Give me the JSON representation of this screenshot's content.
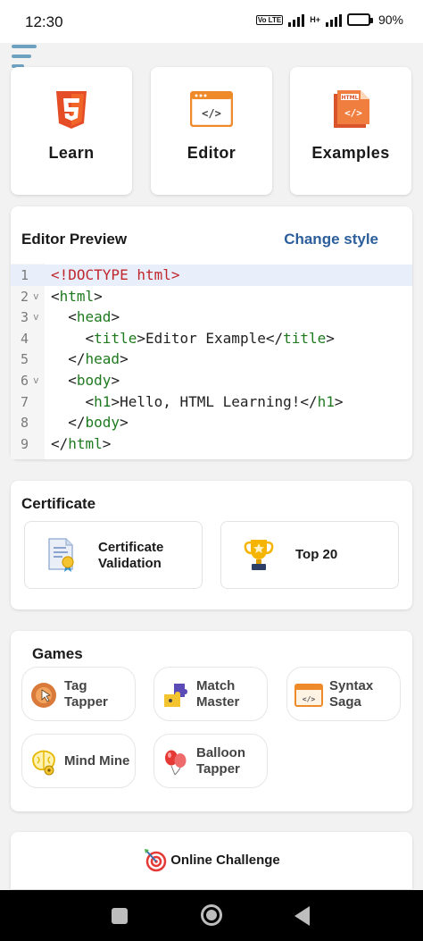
{
  "status_bar": {
    "time": "12:30",
    "battery": "90%",
    "network_tag": "Vo LTE",
    "signal_tag": "H+"
  },
  "tiles": [
    {
      "label": "Learn",
      "icon": "html5-icon"
    },
    {
      "label": "Editor",
      "icon": "code-editor-icon"
    },
    {
      "label": "Examples",
      "icon": "html-document-icon"
    }
  ],
  "editor": {
    "title": "Editor Preview",
    "change_style": "Change style",
    "lines": [
      {
        "num": "1",
        "fold": "",
        "parts": [
          {
            "t": "<!DOCTYPE html>",
            "c": "doc"
          }
        ]
      },
      {
        "num": "2",
        "fold": "v",
        "parts": [
          {
            "t": "<",
            "c": ""
          },
          {
            "t": "html",
            "c": "tag"
          },
          {
            "t": ">",
            "c": ""
          }
        ]
      },
      {
        "num": "3",
        "fold": "v",
        "parts": [
          {
            "t": "  <",
            "c": ""
          },
          {
            "t": "head",
            "c": "tag"
          },
          {
            "t": ">",
            "c": ""
          }
        ]
      },
      {
        "num": "4",
        "fold": "",
        "parts": [
          {
            "t": "    <",
            "c": ""
          },
          {
            "t": "title",
            "c": "tag"
          },
          {
            "t": ">Editor Example</",
            "c": ""
          },
          {
            "t": "title",
            "c": "tag"
          },
          {
            "t": ">",
            "c": ""
          }
        ]
      },
      {
        "num": "5",
        "fold": "",
        "parts": [
          {
            "t": "  </",
            "c": ""
          },
          {
            "t": "head",
            "c": "tag"
          },
          {
            "t": ">",
            "c": ""
          }
        ]
      },
      {
        "num": "6",
        "fold": "v",
        "parts": [
          {
            "t": "  <",
            "c": ""
          },
          {
            "t": "body",
            "c": "tag"
          },
          {
            "t": ">",
            "c": ""
          }
        ]
      },
      {
        "num": "7",
        "fold": "",
        "parts": [
          {
            "t": "    <",
            "c": ""
          },
          {
            "t": "h1",
            "c": "tag"
          },
          {
            "t": ">Hello, HTML Learning!</",
            "c": ""
          },
          {
            "t": "h1",
            "c": "tag"
          },
          {
            "t": ">",
            "c": ""
          }
        ]
      },
      {
        "num": "8",
        "fold": "",
        "parts": [
          {
            "t": "  </",
            "c": ""
          },
          {
            "t": "body",
            "c": "tag"
          },
          {
            "t": ">",
            "c": ""
          }
        ]
      },
      {
        "num": "9",
        "fold": "",
        "parts": [
          {
            "t": "</",
            "c": ""
          },
          {
            "t": "html",
            "c": "tag"
          },
          {
            "t": ">",
            "c": ""
          }
        ]
      }
    ]
  },
  "certificate": {
    "title": "Certificate",
    "validation_line1": "Certificate",
    "validation_line2": "Validation",
    "top": "Top 20"
  },
  "games": {
    "title": "Games",
    "items": [
      {
        "line1": "Tag",
        "line2": "Tapper",
        "icon": "tag-tapper-icon"
      },
      {
        "line1": "Match",
        "line2": "Master",
        "icon": "puzzle-icon"
      },
      {
        "line1": "Syntax",
        "line2": "Saga",
        "icon": "code-window-icon"
      },
      {
        "line1": "Mind Mine",
        "line2": "",
        "icon": "brain-icon"
      },
      {
        "line1": "Balloon",
        "line2": "Tapper",
        "icon": "balloon-icon"
      }
    ]
  },
  "online_challenge": "Online Challenge",
  "colors": {
    "accent_blue": "#2b5e9a",
    "tag_green": "#1f7a1f",
    "doctype_red": "#c0272d",
    "html5_orange": "#e44d26"
  }
}
